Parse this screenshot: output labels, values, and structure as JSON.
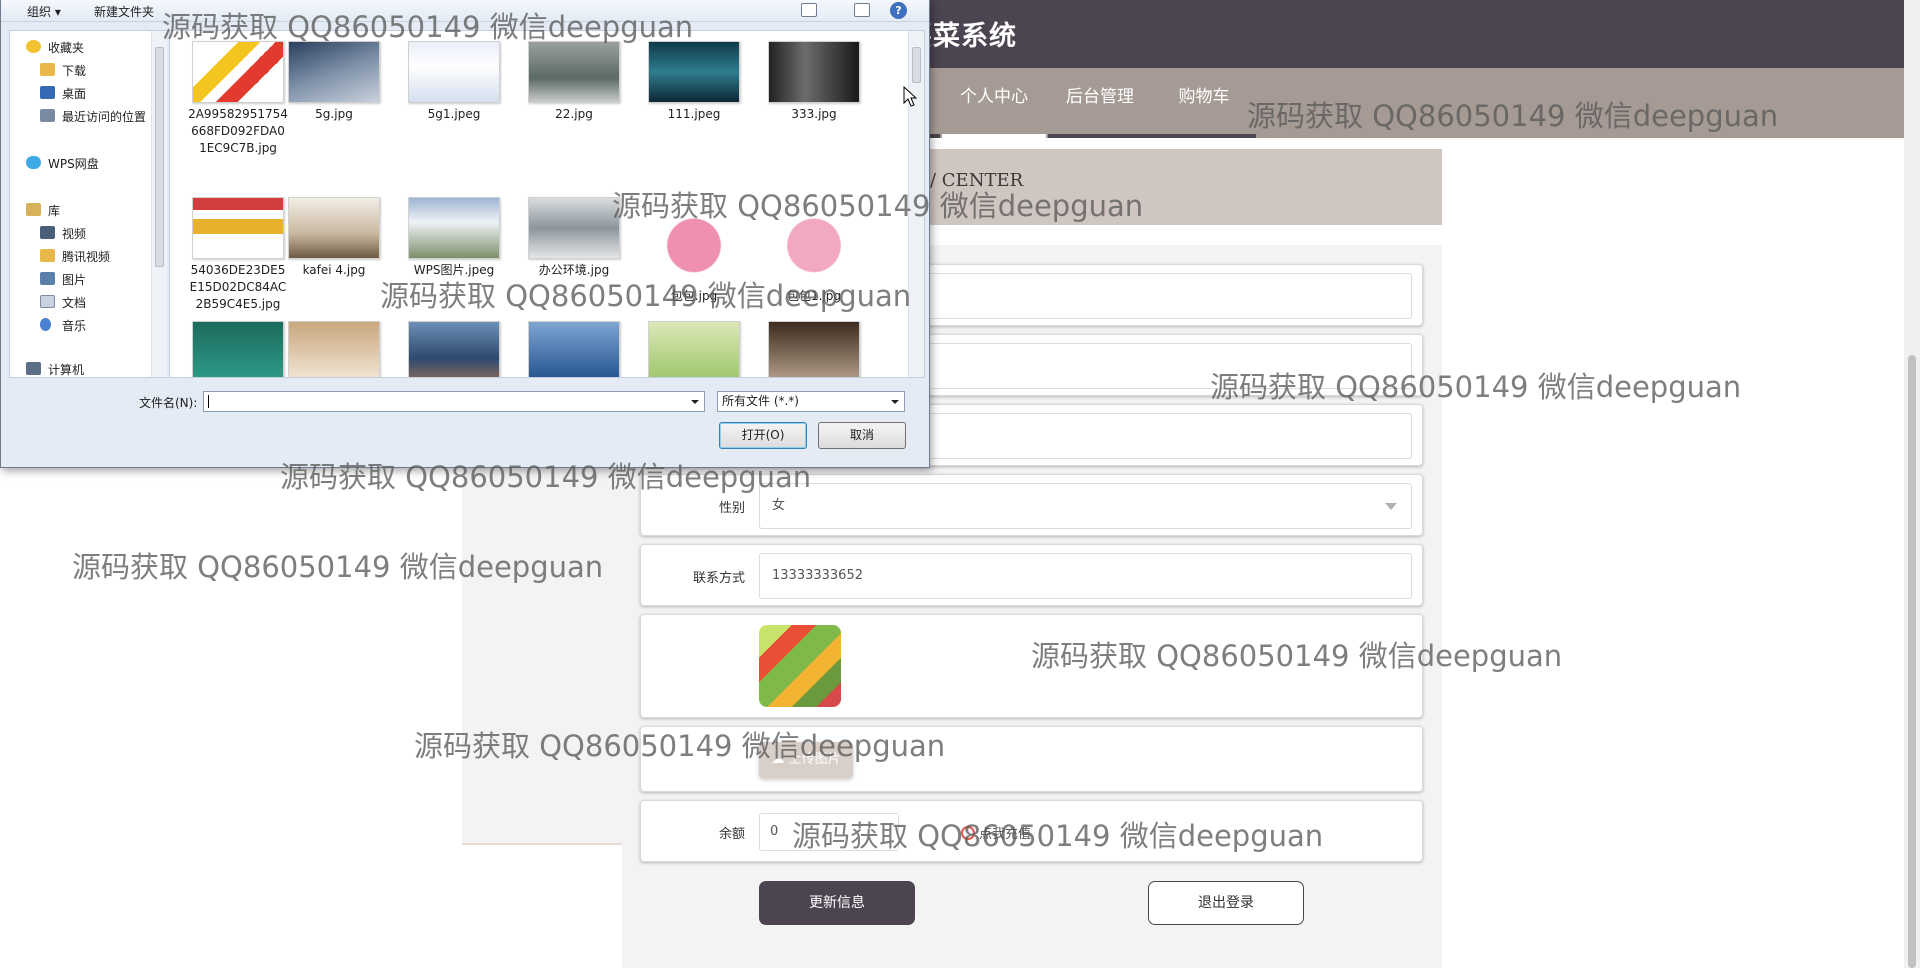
{
  "site": {
    "title": "买菜系统",
    "nav": [
      "个人中心",
      "后台管理",
      "购物车"
    ],
    "breadcrumb": "/ CENTER"
  },
  "form": {
    "gender": {
      "label": "性别",
      "value": "女"
    },
    "contact": {
      "label": "联系方式",
      "value": "13333333652"
    },
    "upload_label": "上传图片",
    "balance": {
      "label": "余额",
      "value": "0",
      "recharge": "点我充值"
    },
    "update_button": "更新信息",
    "logout_button": "退出登录"
  },
  "dialog": {
    "toolbar": {
      "organize": "组织 ▾",
      "new_folder": "新建文件夹"
    },
    "tree": [
      "收藏夹",
      "下载",
      "桌面",
      "最近访问的位置",
      "WPS网盘",
      "库",
      "视频",
      "腾讯视频",
      "图片",
      "文档",
      "音乐",
      "计算机"
    ],
    "files": [
      "2A99582951754668FD092FDA01EC9C7B.jpg",
      "5g.jpg",
      "5g1.jpeg",
      "22.jpg",
      "111.jpeg",
      "333.jpg",
      "54036DE23DE5E15D02DC84AC2B59C4E5.jpg",
      "kafei 4.jpg",
      "WPS图片.jpeg",
      "办公环境.jpg",
      "包包.jpg",
      "包包1.jpg",
      "",
      "",
      "",
      "",
      "",
      ""
    ],
    "filename_label": "文件名(N):",
    "filename_value": "",
    "filetype": "所有文件 (*.*)",
    "open_button": "打开(O)",
    "cancel_button": "取消"
  },
  "watermark": "源码获取 QQ86050149 微信deepguan",
  "colors": {
    "header": "#4c4451",
    "nav": "#a69a94",
    "breadcrumb_bg": "#d0c6c1"
  }
}
